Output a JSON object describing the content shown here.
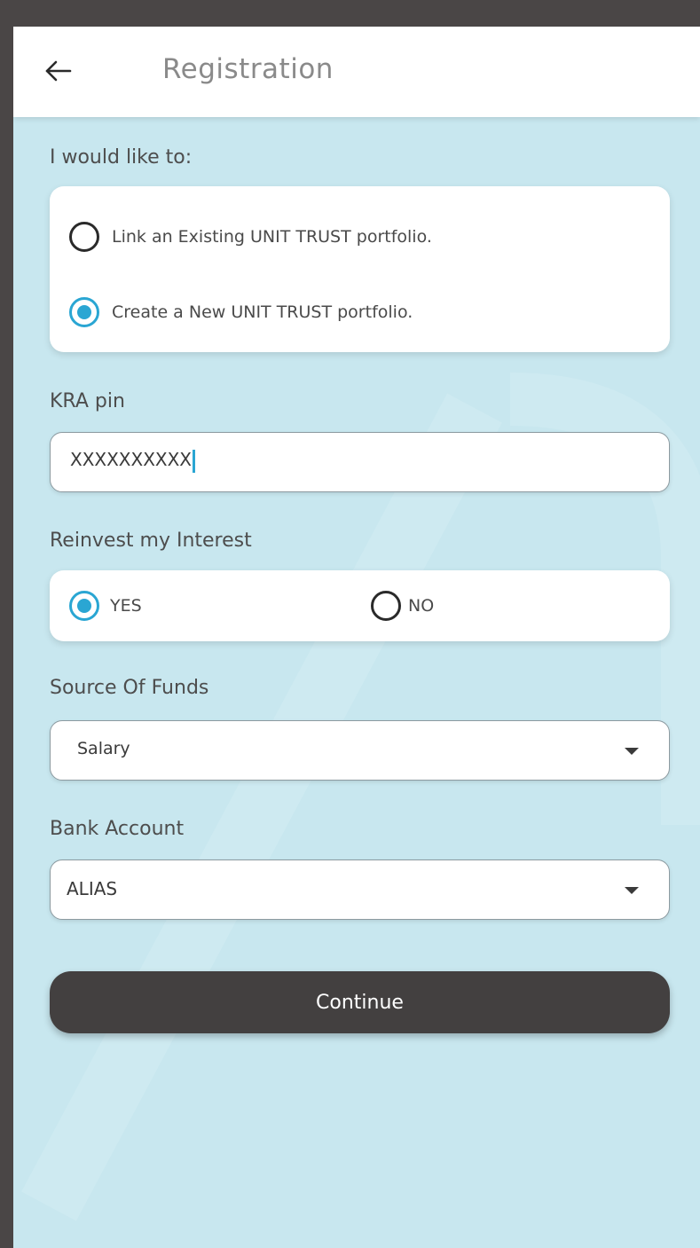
{
  "header": {
    "title": "Registration",
    "back_icon": "arrow-left-icon"
  },
  "portfolio": {
    "label": "I would like to:",
    "options": [
      {
        "label": "Link an Existing UNIT TRUST portfolio.",
        "selected": false
      },
      {
        "label": "Create a New UNIT TRUST portfolio.",
        "selected": true
      }
    ]
  },
  "kra": {
    "label": "KRA pin",
    "value": "XXXXXXXXXX"
  },
  "reinvest": {
    "label": "Reinvest my Interest",
    "options": [
      {
        "label": "YES",
        "selected": true
      },
      {
        "label": "NO",
        "selected": false
      }
    ]
  },
  "source_of_funds": {
    "label": "Source Of Funds",
    "selected": "Salary"
  },
  "bank_account": {
    "label": "Bank Account",
    "selected": "ALIAS"
  },
  "actions": {
    "continue_label": "Continue"
  },
  "colors": {
    "background": "#c8e7ef",
    "accent": "#2aa6d3",
    "button": "#434040"
  }
}
